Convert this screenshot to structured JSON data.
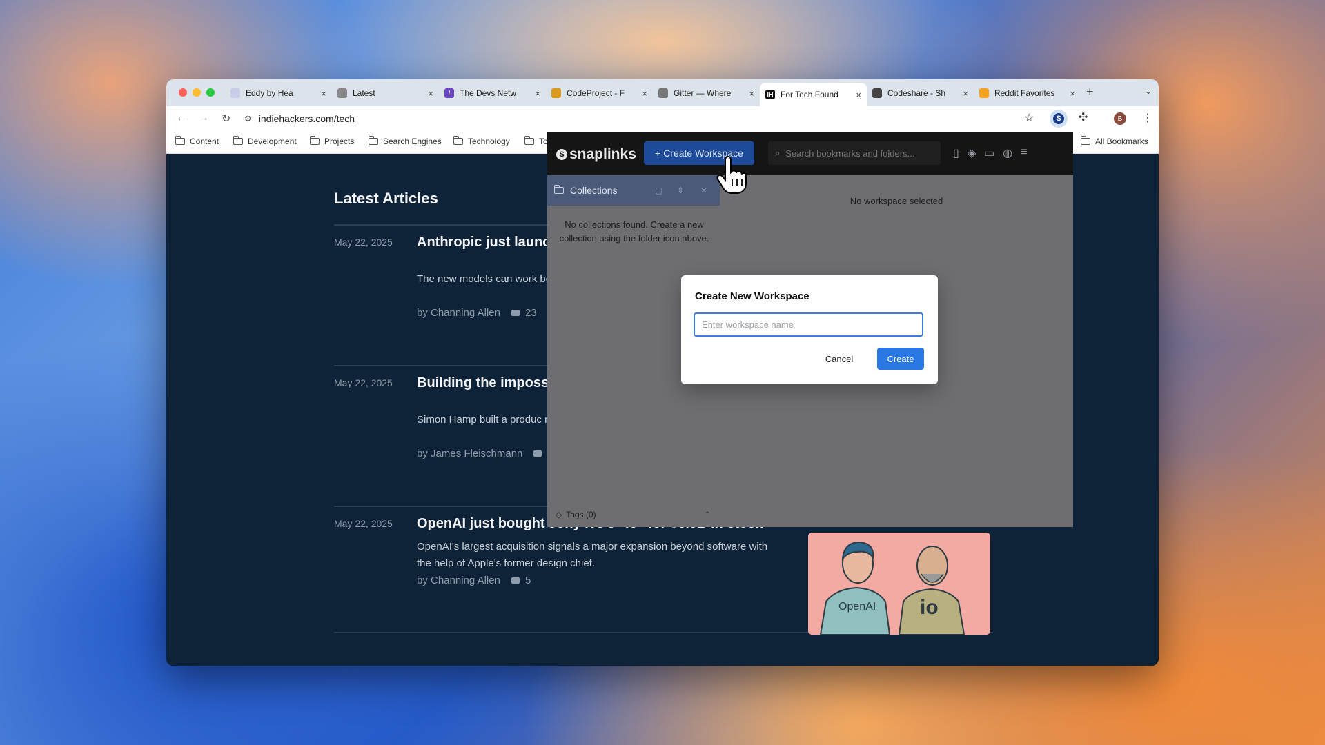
{
  "browser": {
    "tabs": [
      {
        "label": "Eddy by Hea",
        "fav_color": "#c8cde8",
        "fav_glyph": ""
      },
      {
        "label": "Latest",
        "fav_color": "#888888",
        "fav_glyph": ""
      },
      {
        "label": "The Devs Netw",
        "fav_color": "#6b46c1",
        "fav_glyph": "/"
      },
      {
        "label": "CodeProject - F",
        "fav_color": "#d99a1e",
        "fav_glyph": ""
      },
      {
        "label": "Gitter — Where",
        "fav_color": "#777777",
        "fav_glyph": ""
      },
      {
        "label": "For Tech Found",
        "fav_color": "#111111",
        "fav_glyph": "IH",
        "active": true
      },
      {
        "label": "Codeshare - Sh",
        "fav_color": "#444444",
        "fav_glyph": ""
      },
      {
        "label": "Reddit Favorites",
        "fav_color": "#f4a21e",
        "fav_glyph": ""
      }
    ],
    "new_tab": "+",
    "url": "indiehackers.com/tech",
    "avatar_letter": "B",
    "bookmarks": [
      "Content",
      "Development",
      "Projects",
      "Search Engines",
      "Technology",
      "To"
    ],
    "all_bookmarks": "All Bookmarks"
  },
  "page": {
    "heading": "Latest Articles",
    "articles": [
      {
        "date": "May 22, 2025",
        "title": "Anthropic just launch in AI coding",
        "excerpt": "The new models can work between reasoning and usi",
        "author": "by Channing Allen",
        "comments": "23"
      },
      {
        "date": "May 22, 2025",
        "title": "Building the impossi three months",
        "excerpt": "Simon Hamp built a produc mobile apps in PHP. Within",
        "author": "by James Fleischmann",
        "comments": ""
      },
      {
        "date": "May 22, 2025",
        "title": "OpenAI just bought Jony Ive's \"io\" for $6.5B in stock",
        "excerpt": "OpenAI's largest acquisition signals a major expansion beyond software with the help of Apple's former design chief.",
        "author": "by Channing Allen",
        "comments": "5",
        "badge": "+"
      }
    ],
    "thumbnail_labels": [
      "OpenAI",
      "io"
    ]
  },
  "extension": {
    "logo": "snaplinks",
    "create_workspace_btn": "+ Create Workspace",
    "search_placeholder": "Search bookmarks and folders...",
    "collections_label": "Collections",
    "no_collections": "No collections found. Create a new collection using the folder icon above.",
    "no_workspace": "No workspace selected",
    "tags_label": "Tags (0)"
  },
  "modal": {
    "title": "Create New Workspace",
    "input_placeholder": "Enter workspace name",
    "input_value": "",
    "cancel": "Cancel",
    "create": "Create"
  },
  "colors": {
    "accent": "#2a78e4",
    "page_bg": "#0f2338",
    "extension_header": "#151515"
  }
}
